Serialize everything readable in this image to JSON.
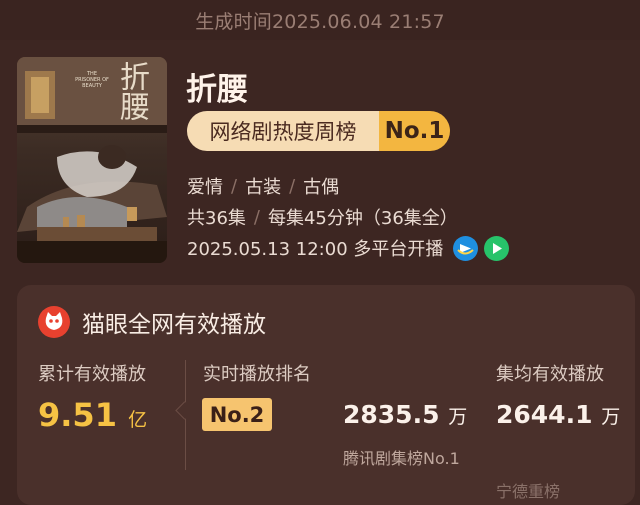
{
  "header": {
    "generated_time": "生成时间2025.06.04 21:57"
  },
  "drama": {
    "title": "折腰",
    "rank_badge": {
      "label": "网络剧热度周榜",
      "value": "No.1"
    },
    "tags": [
      "爱情",
      "古装",
      "古偶"
    ],
    "episodes": "共36集",
    "duration": "每集45分钟（36集全）",
    "premiere": "2025.05.13 12:00 多平台开播",
    "poster_text": {
      "title": "折腰",
      "subtitle": "THE PRISONER OF BEAUTY"
    },
    "platform_icons": [
      "tencent-video-icon",
      "iqiyi-play-icon"
    ]
  },
  "stats": {
    "card_title": "猫眼全网有效播放",
    "cumulative": {
      "label": "累计有效播放",
      "value": "9.51",
      "unit": "亿"
    },
    "realtime": {
      "label": "实时播放排名",
      "rank": "No.2",
      "value": "2835.5",
      "unit": "万",
      "note": "腾讯剧集榜No.1"
    },
    "per_episode": {
      "label": "集均有效播放",
      "value": "2644.1",
      "unit": "万",
      "note": "宁德重榜"
    }
  },
  "colors": {
    "background": "#3d2622",
    "card": "#4a302b",
    "accent_gold": "#f3b640",
    "highlight_value": "#f6c244",
    "maoyan_red": "#e8412f"
  }
}
